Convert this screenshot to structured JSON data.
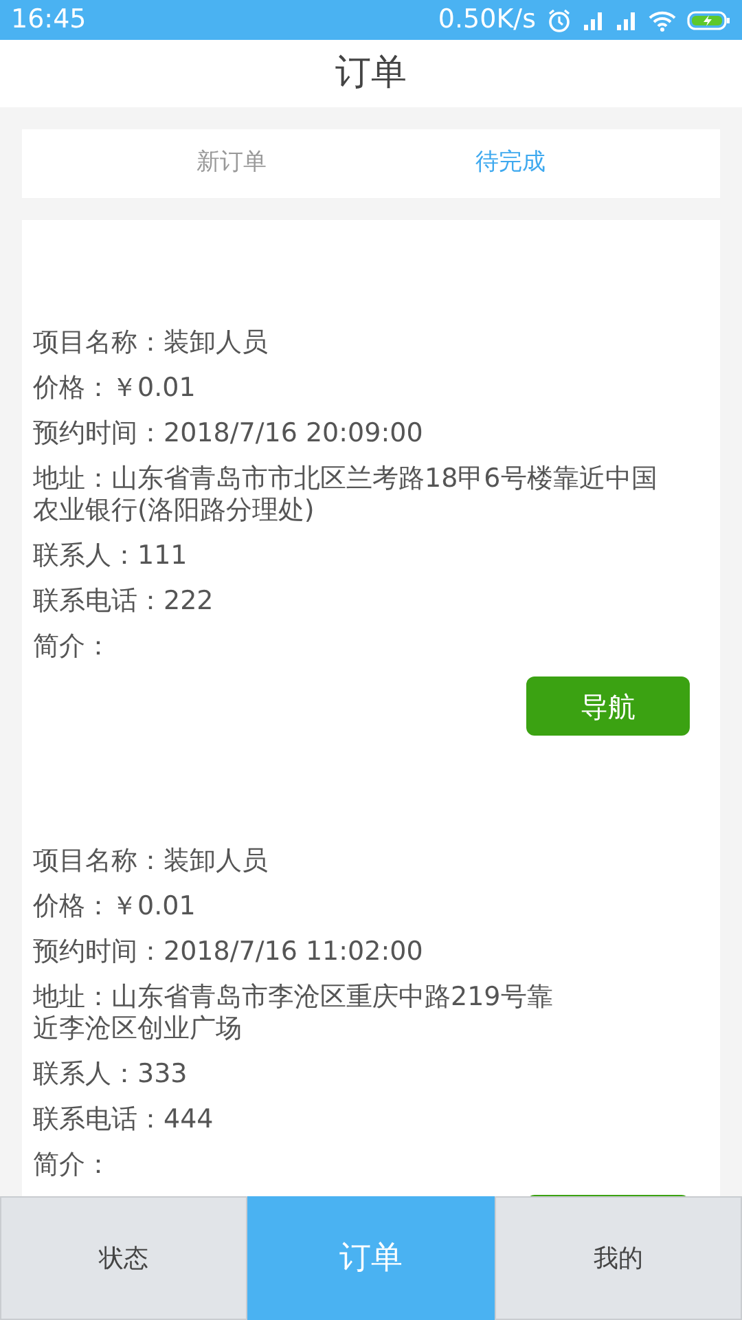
{
  "status_bar": {
    "time": "16:45",
    "speed": "0.50K/s"
  },
  "title": "订单",
  "tabs": [
    {
      "label": "新订单",
      "selected": false
    },
    {
      "label": "待完成",
      "selected": true
    }
  ],
  "orders": [
    {
      "lines": [
        "项目名称：装卸人员",
        "价格：￥0.01",
        "预约时间：2018/7/16 20:09:00",
        "地址：山东省青岛市市北区兰考路18甲6号楼靠近中国农业银行(洛阳路分理处)",
        "联系人：111",
        "联系电话：222",
        "简介："
      ],
      "button": "导航"
    },
    {
      "lines": [
        "项目名称：装卸人员",
        "价格：￥0.01",
        "预约时间：2018/7/16 11:02:00",
        [
          "地址：山东省青岛市李沧区重庆中路219号靠",
          "近李沧区创业广场"
        ],
        "联系人：333",
        "联系电话：444",
        "简介："
      ],
      "has_button": true
    }
  ],
  "bottom_nav": [
    {
      "label": "状态",
      "selected": false
    },
    {
      "label": "订单",
      "selected": true
    },
    {
      "label": "我的",
      "selected": false
    }
  ]
}
